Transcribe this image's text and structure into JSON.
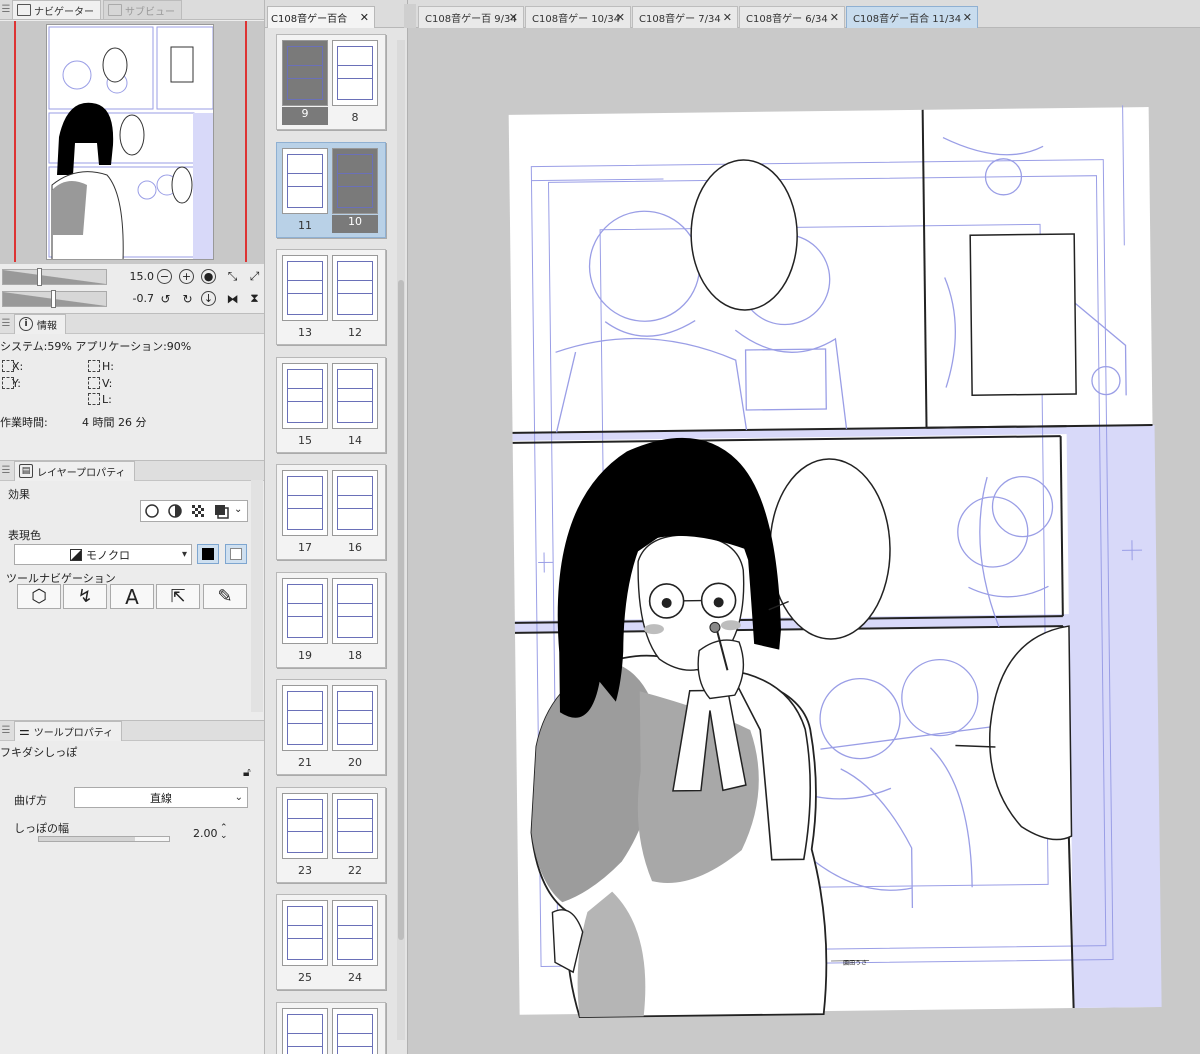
{
  "left_panel": {
    "navigator_tab": "ナビゲーター",
    "subview_tab": "サブビュー",
    "zoom_value": "15.0",
    "rotation_value": "-0.7",
    "info_header": "情報",
    "memory_text": "システム:59%  アプリケーション:90%",
    "coord_labels": {
      "x": "X:",
      "y": "Y:",
      "h": "H:",
      "v": "V:",
      "l": "L:"
    },
    "work_time_label": "作業時間:",
    "work_time_value": "4 時間 26 分",
    "layer_props_header": "レイヤープロパティ",
    "effect_label": "効果",
    "expression_color_label": "表現色",
    "expression_color_value": "モノクロ",
    "tool_nav_label": "ツールナビゲーション",
    "tool_props_header": "ツールプロパティ",
    "tool_name": "フキダシしっぽ",
    "bend_label": "曲げ方",
    "bend_value": "直線",
    "tail_width_label": "しっぽの幅",
    "tail_width_value": "2.00"
  },
  "page_manager": {
    "file_tab": "C108音ゲー百合",
    "spreads": [
      {
        "left": "9",
        "right": "8",
        "selected": false,
        "dark_left": true,
        "dark_right": false
      },
      {
        "left": "11",
        "right": "10",
        "selected": true,
        "dark_left": false,
        "dark_right": true
      },
      {
        "left": "13",
        "right": "12",
        "selected": false
      },
      {
        "left": "15",
        "right": "14",
        "selected": false
      },
      {
        "left": "17",
        "right": "16",
        "selected": false
      },
      {
        "left": "19",
        "right": "18",
        "selected": false
      },
      {
        "left": "21",
        "right": "20",
        "selected": false
      },
      {
        "left": "23",
        "right": "22",
        "selected": false
      },
      {
        "left": "25",
        "right": "24",
        "selected": false
      },
      {
        "left": "",
        "right": "",
        "selected": false
      }
    ]
  },
  "doc_tabs": [
    {
      "label": "C108音ゲー百 9/34",
      "active": false
    },
    {
      "label": "C108音ゲー 10/34",
      "active": false
    },
    {
      "label": "C108音ゲー 7/34",
      "active": false
    },
    {
      "label": "C108音ゲー 6/34",
      "active": false
    },
    {
      "label": "C108音ゲー百合 11/34",
      "active": true
    }
  ],
  "canvas": {
    "author_credit": "園田うさ"
  },
  "colors": {
    "accent_blue": "#c8dcee",
    "sketch_blue": "#9a9ee6",
    "panel_fill": "#d8d9f9"
  }
}
